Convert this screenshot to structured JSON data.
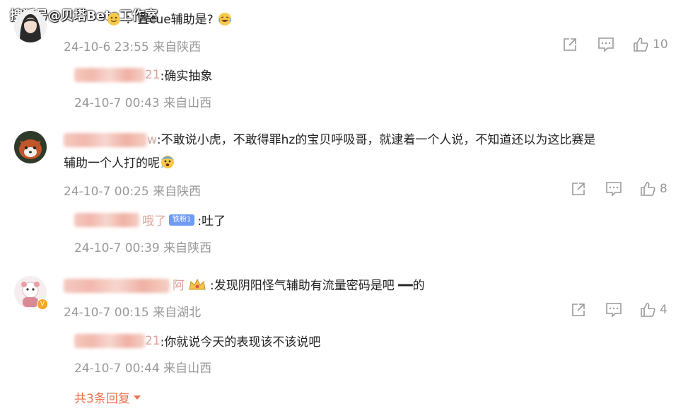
{
  "watermark": "搜狐号@贝塔Beta工作室",
  "comments": [
    {
      "text": "：置cue辅助是?",
      "time": "24-10-6 23:55 来自陕西",
      "likes": "10",
      "reply": {
        "name_suffix": "21",
        "text": ":确实抽象",
        "time": "24-10-7 00:43 来自山西"
      }
    },
    {
      "name_suffix": "w",
      "text_line1": ":不敢说小虎，不敢得罪hz的宝贝呼吸哥，就逮着一个人说，不知道还以为这比赛是",
      "text_line2": "辅助一个人打的呢",
      "time": "24-10-7 00:25 来自陕西",
      "likes": "8",
      "reply": {
        "name_suffix": "哦了",
        "badge": "铁粉1",
        "text": ":吐了",
        "time": "24-10-7 00:39 来自陕西"
      }
    },
    {
      "name_suffix": "阿",
      "text": ":发现阴阳怪气辅助有流量密码是吧 ━━的",
      "time": "24-10-7 00:15 来自湖北",
      "likes": "4",
      "reply": {
        "name_suffix": "21",
        "text": ":你就说今天的表现该不该说吧",
        "time": "24-10-7 00:44 来自山西"
      },
      "more_replies": "共3条回复"
    }
  ],
  "icons": [
    "share-icon",
    "comment-icon",
    "like-icon",
    "chevron-down-icon"
  ],
  "colors": {
    "meta": "#999999",
    "link": "#eb7350",
    "text": "#222222"
  }
}
